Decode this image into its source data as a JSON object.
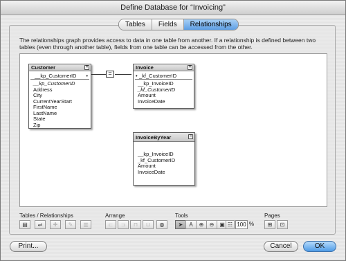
{
  "window": {
    "title": "Define Database for “Invoicing”"
  },
  "tabs": [
    {
      "label": "Tables",
      "active": false
    },
    {
      "label": "Fields",
      "active": false
    },
    {
      "label": "Relationships",
      "active": true
    }
  ],
  "description": "The relationships graph provides access to data in one table from another. If a relationship is defined between two tables (even through another table), fields from one table can be accessed from the other.",
  "graph": {
    "relationship_operator": "=",
    "tables": {
      "customer": {
        "name": "Customer",
        "key_field": "__kp_CustomerID",
        "fields": [
          "__kp_CustomerID",
          "Address",
          "City",
          "CurrentYearStart",
          "FirstName",
          "LastName",
          "State",
          "Zip"
        ]
      },
      "invoice": {
        "name": "Invoice",
        "key_field": "_kf_CustomerID",
        "fields": [
          "__kp_InvoiceID",
          "_kf_CustomerID",
          "Amount",
          "InvoiceDate"
        ]
      },
      "invoice_by_year": {
        "name": "InvoiceByYear",
        "fields": [
          "__kp_InvoiceID",
          "_kf_CustomerID",
          "Amount",
          "InvoiceDate"
        ]
      }
    }
  },
  "toolbar": {
    "tables_relationships_label": "Tables / Relationships",
    "arrange_label": "Arrange",
    "tools_label": "Tools",
    "pages_label": "Pages",
    "zoom_value": "100",
    "zoom_unit": "%"
  },
  "buttons": {
    "print": "Print...",
    "cancel": "Cancel",
    "ok": "OK"
  }
}
